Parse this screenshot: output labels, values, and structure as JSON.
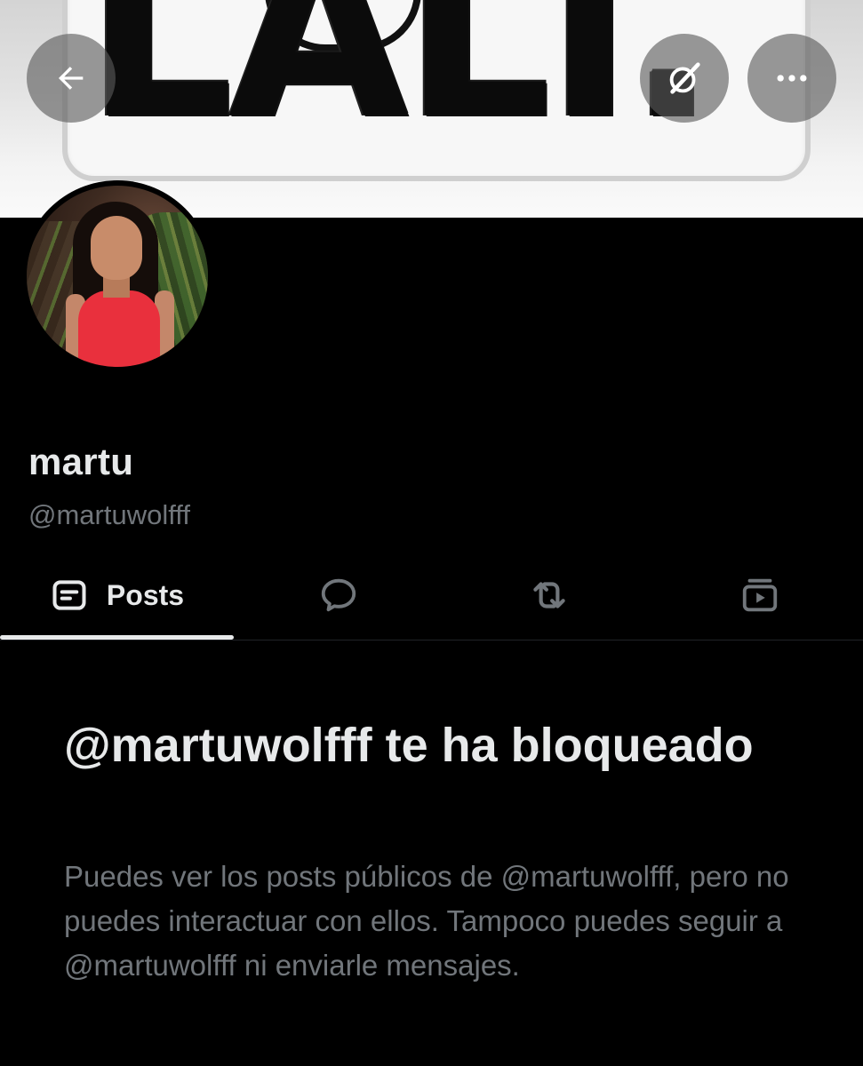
{
  "banner": {
    "text": "LALI."
  },
  "header": {
    "back_icon": "arrow-left-icon",
    "grok_icon": "grok-slash-icon",
    "more_icon": "more-horizontal-icon"
  },
  "profile": {
    "display_name": "martu",
    "handle": "@martuwolfff"
  },
  "tabs": {
    "posts_label": "Posts",
    "posts_icon": "posts-icon",
    "replies_icon": "reply-bubble-icon",
    "reposts_icon": "repost-icon",
    "media_icon": "media-play-icon"
  },
  "blocked": {
    "title": "@martuwolfff te ha bloqueado",
    "description": "Puedes ver los posts públicos de @martuwolfff, pero no puedes interactuar con ellos. Tampoco puedes seguir a @martuwolfff ni enviarle mensajes."
  },
  "colors": {
    "background": "#000000",
    "primary_text": "#e7e9ea",
    "secondary_text": "#71767b",
    "button_overlay": "#5a5a5a"
  }
}
